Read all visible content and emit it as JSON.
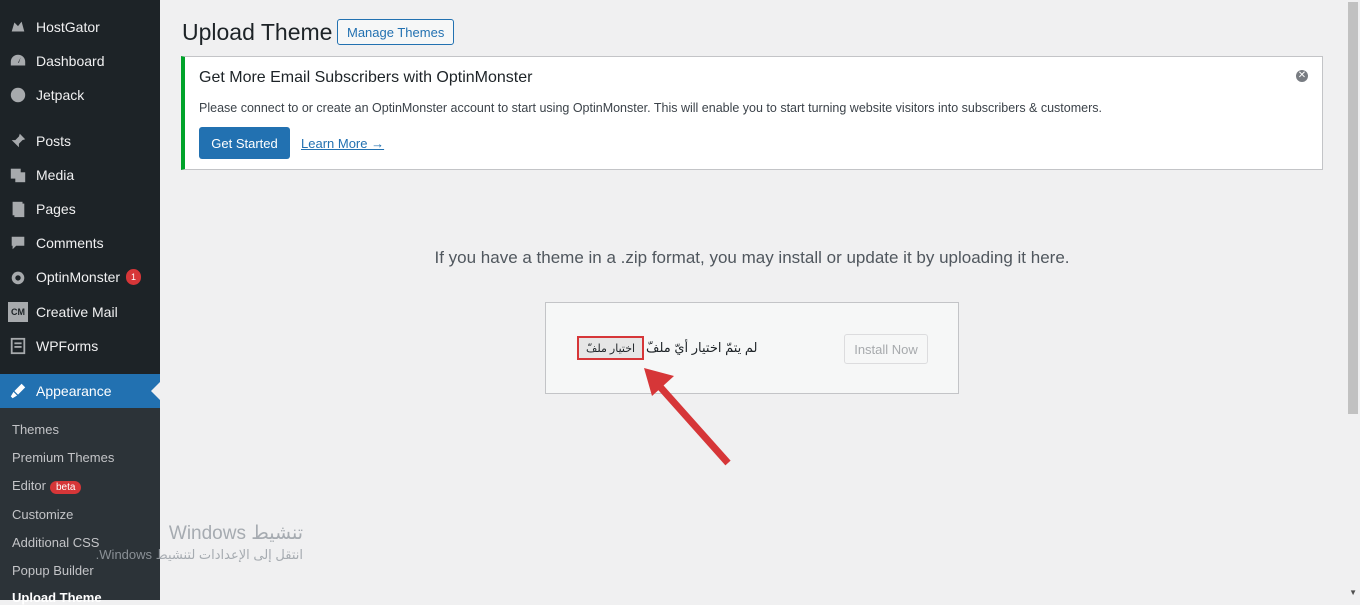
{
  "sidebar": {
    "items": [
      {
        "label": "HostGator",
        "icon": "hostgator-icon"
      },
      {
        "label": "Dashboard",
        "icon": "dashboard-icon"
      },
      {
        "label": "Jetpack",
        "icon": "jetpack-icon"
      },
      {
        "label": "Posts",
        "icon": "pin-icon"
      },
      {
        "label": "Media",
        "icon": "media-icon"
      },
      {
        "label": "Pages",
        "icon": "pages-icon"
      },
      {
        "label": "Comments",
        "icon": "comments-icon"
      },
      {
        "label": "OptinMonster",
        "icon": "optinmonster-icon",
        "badge": "1"
      },
      {
        "label": "Creative Mail",
        "icon": "creative-mail-icon",
        "icon_text": "CM"
      },
      {
        "label": "WPForms",
        "icon": "wpforms-icon"
      },
      {
        "label": "Appearance",
        "icon": "brush-icon",
        "active": true
      }
    ],
    "submenu": [
      {
        "label": "Themes"
      },
      {
        "label": "Premium Themes"
      },
      {
        "label": "Editor",
        "badge": "beta"
      },
      {
        "label": "Customize"
      },
      {
        "label": "Additional CSS"
      },
      {
        "label": "Popup Builder"
      },
      {
        "label": "Upload Theme",
        "current": true
      }
    ]
  },
  "header": {
    "title": "Upload Theme",
    "manage_themes": "Manage Themes"
  },
  "notice": {
    "title": "Get More Email Subscribers with OptinMonster",
    "text": "Please connect to or create an OptinMonster account to start using OptinMonster. This will enable you to start turning website visitors into subscribers & customers.",
    "get_started": "Get Started",
    "learn_more": "Learn More →",
    "border_color": "#00a32a"
  },
  "upload": {
    "intro": "If you have a theme in a .zip format, you may install or update it by uploading it here.",
    "choose_file": "اختيار ملفّ",
    "no_file": "لم يتمّ اختيار أيّ ملفّ",
    "install_now": "Install Now"
  },
  "watermark": {
    "title": "تنشيط Windows",
    "subtitle": "انتقل إلى الإعدادات لتنشيط Windows."
  },
  "colors": {
    "accent": "#2271b1",
    "sidebar": "#1d2327",
    "highlight": "#d63638"
  }
}
